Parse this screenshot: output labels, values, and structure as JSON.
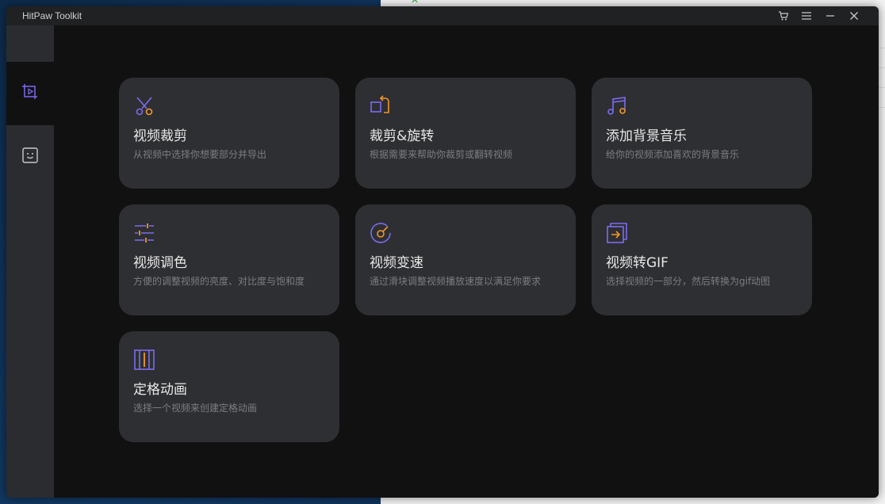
{
  "app": {
    "title": "HitPaw Toolkit"
  },
  "titlebar": {
    "icons": [
      "cart-icon",
      "menu-icon",
      "minimize-icon",
      "close-icon"
    ]
  },
  "sidebar": {
    "items": [
      {
        "icon": "video-edit-icon",
        "active": true
      },
      {
        "icon": "smiley-icon",
        "active": false
      }
    ]
  },
  "cards": [
    {
      "title": "视频裁剪",
      "desc": "从视频中选择你想要部分并导出",
      "icon": "scissors-icon"
    },
    {
      "title": "裁剪&旋转",
      "desc": "根据需要来帮助你裁剪或翻转视频",
      "icon": "crop-rotate-icon"
    },
    {
      "title": "添加背景音乐",
      "desc": "给你的视频添加喜欢的背景音乐",
      "icon": "music-note-icon"
    },
    {
      "title": "视频调色",
      "desc": "方便的调整视频的亮度、对比度与饱和度",
      "icon": "sliders-icon"
    },
    {
      "title": "视频变速",
      "desc": "通过滑块调整视频播放速度以满足你要求",
      "icon": "speed-gauge-icon"
    },
    {
      "title": "视频转GIF",
      "desc": "选择视频的一部分，然后转换为gif动图",
      "icon": "gif-convert-icon"
    },
    {
      "title": "定格动画",
      "desc": "选择一个视频来创建定格动画",
      "icon": "film-frames-icon"
    }
  ],
  "colors": {
    "accent_purple": "#7b6cf0",
    "accent_orange": "#f2962d"
  }
}
